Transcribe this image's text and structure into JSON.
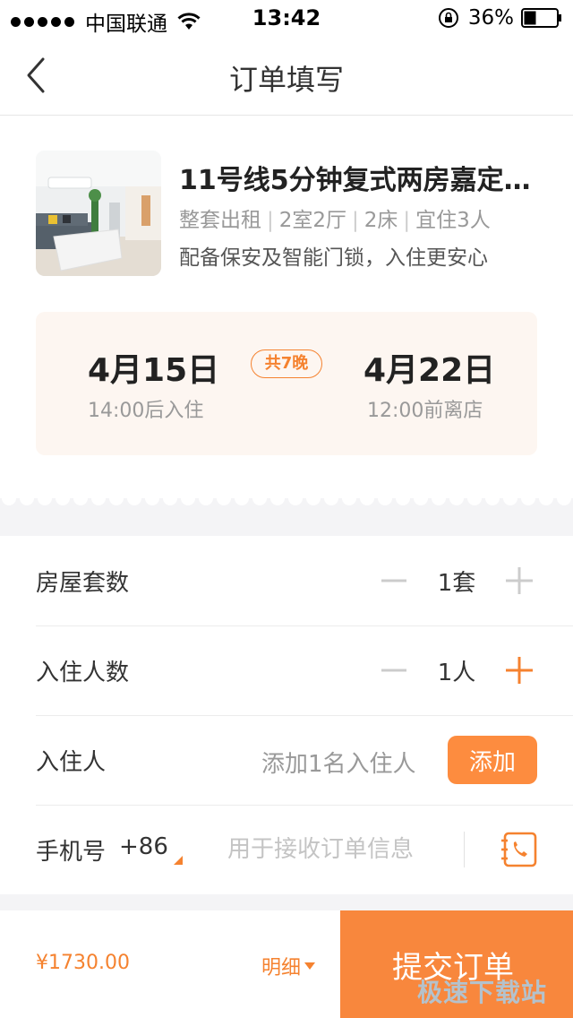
{
  "status_bar": {
    "carrier": "中国联通",
    "time": "13:42",
    "battery": "36%"
  },
  "nav": {
    "title": "订单填写"
  },
  "listing": {
    "title": "11号线5分钟复式两房嘉定…",
    "specs": [
      "整套出租",
      "2室2厅",
      "2床",
      "宜住3人"
    ],
    "specs_separator": "|",
    "feature": "配备保安及智能门锁，入住更安心"
  },
  "dates": {
    "checkin": "4月15日",
    "checkin_note": "14:00后入住",
    "nights": "共7晚",
    "checkout": "4月22日",
    "checkout_note": "12:00前离店"
  },
  "form": {
    "rooms": {
      "label": "房屋套数",
      "value": "1套"
    },
    "guests_count": {
      "label": "入住人数",
      "value": "1人"
    },
    "guests": {
      "label": "入住人",
      "hint": "添加1名入住人",
      "button": "添加"
    },
    "phone": {
      "label": "手机号",
      "country_code": "+86",
      "placeholder": "用于接收订单信息"
    }
  },
  "bottom": {
    "total": "¥1730.00",
    "detail_label": "明细",
    "submit_label": "提交订单"
  },
  "watermark": "极速下载站",
  "colors": {
    "accent": "#f5822f",
    "date_card_bg": "#fdf6f1",
    "divider": "#ececec"
  },
  "icons": [
    "back-icon",
    "wifi-icon",
    "lock-icon",
    "battery-icon",
    "minus-icon",
    "plus-icon",
    "contacts-icon",
    "dropdown-triangle-icon"
  ]
}
